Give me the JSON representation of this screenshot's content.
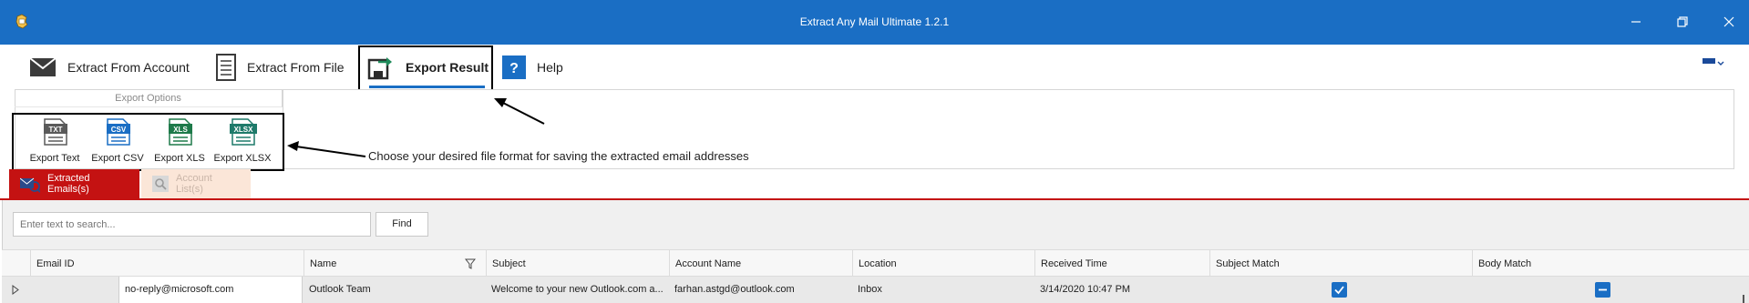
{
  "window": {
    "title": "Extract Any Mail Ultimate 1.2.1",
    "accent_color": "#1a6ec4"
  },
  "menu": {
    "items": [
      {
        "label": "Extract From Account",
        "icon": "envelope-icon"
      },
      {
        "label": "Extract From File",
        "icon": "document-icon"
      },
      {
        "label": "Export Result",
        "icon": "export-icon"
      },
      {
        "label": "Help",
        "icon": "help-icon"
      }
    ],
    "active_index": 2
  },
  "export_options": {
    "header": "Export Options",
    "buttons": [
      {
        "label": "Export Text",
        "badge": "TXT",
        "color": "#5a5a5a"
      },
      {
        "label": "Export CSV",
        "badge": "CSV",
        "color": "#1a6ec4"
      },
      {
        "label": "Export XLS",
        "badge": "XLS",
        "color": "#1e7a4a"
      },
      {
        "label": "Export XLSX",
        "badge": "XLSX",
        "color": "#1e7a6a"
      }
    ]
  },
  "annotation": "Choose your desired file format for saving the extracted email addresses",
  "tabs": [
    {
      "label": "Extracted Emails(s)",
      "active": true
    },
    {
      "label": "Account List(s)",
      "active": false
    }
  ],
  "search": {
    "placeholder": "Enter text to search...",
    "find_label": "Find"
  },
  "grid": {
    "columns": [
      "Email ID",
      "Name",
      "Subject",
      "Account Name",
      "Location",
      "Received Time",
      "Subject Match",
      "Body Match"
    ],
    "rows": [
      {
        "email": "no-reply@microsoft.com",
        "name": "Outlook Team",
        "subject": "Welcome to your new Outlook.com a...",
        "account": "farhan.astgd@outlook.com",
        "location": "Inbox",
        "received": "3/14/2020 10:47 PM",
        "subject_match": true,
        "body_match": "partial"
      }
    ]
  }
}
